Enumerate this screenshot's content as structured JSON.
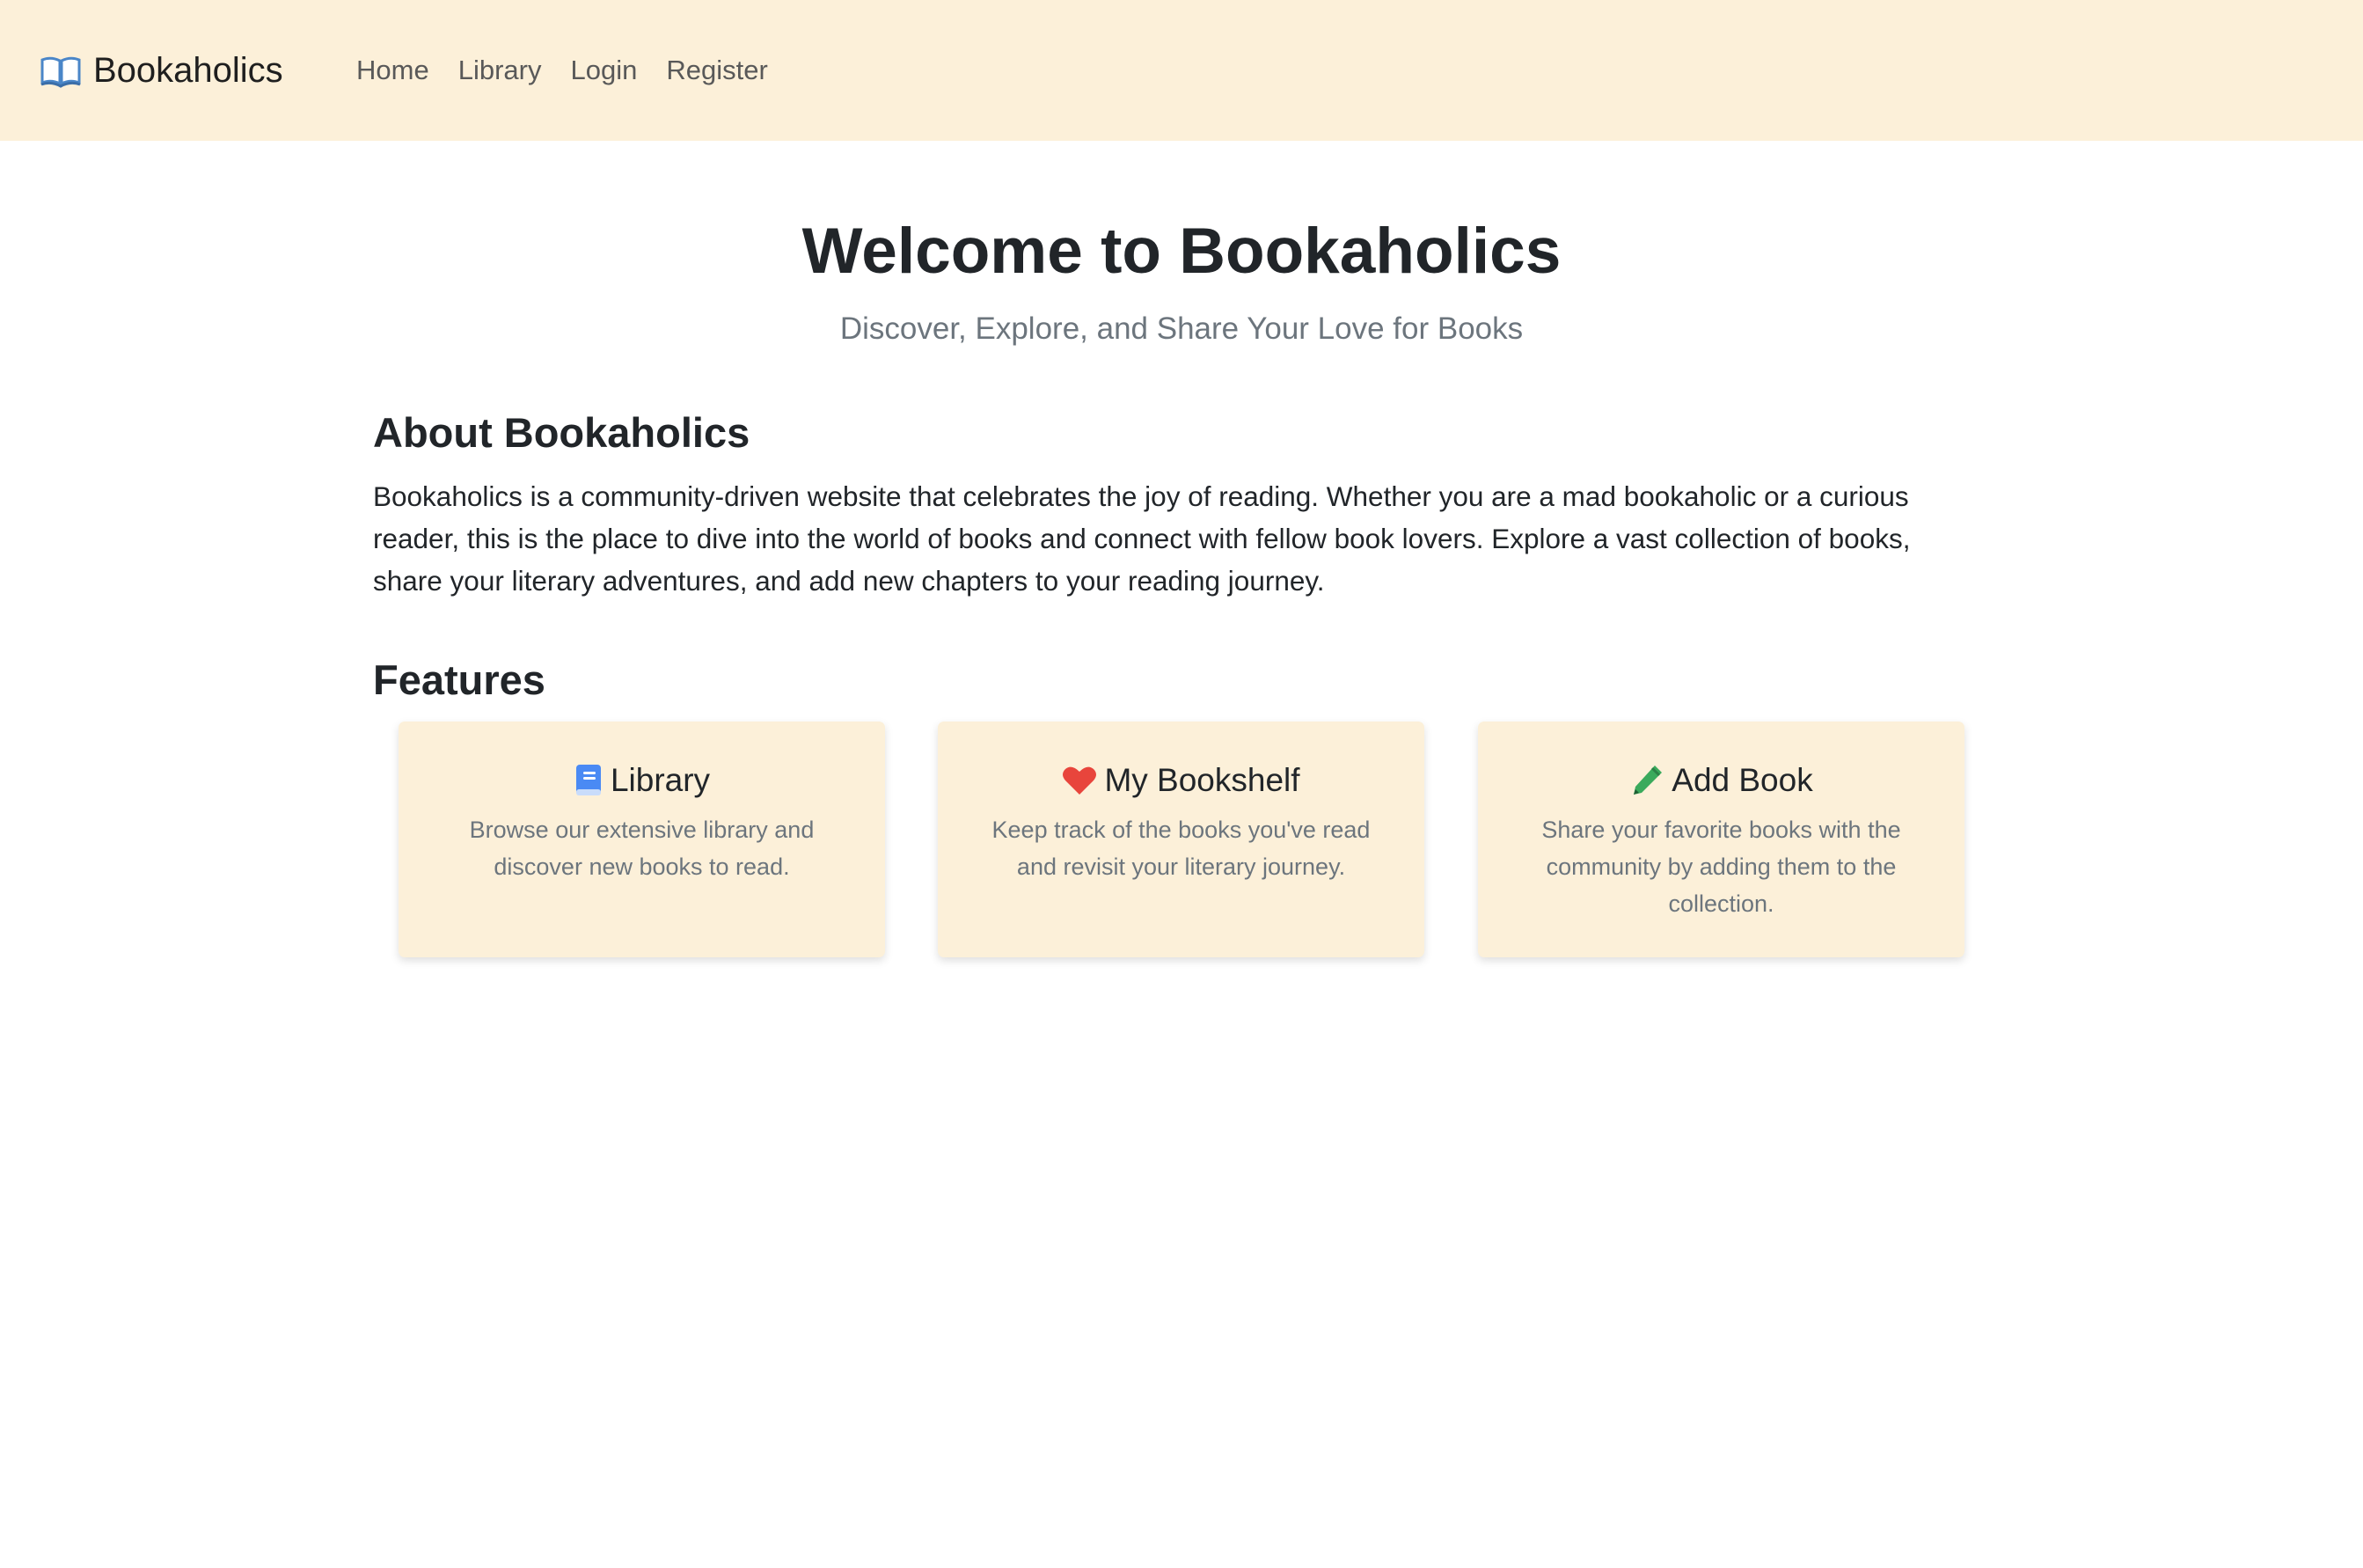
{
  "navbar": {
    "brand_icon": "open-book-icon",
    "brand": "Bookaholics",
    "links": [
      "Home",
      "Library",
      "Login",
      "Register"
    ]
  },
  "hero": {
    "title": "Welcome to Bookaholics",
    "subtitle": "Discover, Explore, and Share Your Love for Books"
  },
  "about": {
    "heading": "About Bookaholics",
    "text": "Bookaholics is a community-driven website that celebrates the joy of reading. Whether you are a mad bookaholic or a curious reader, this is the place to dive into the world of books and connect with fellow book lovers. Explore a vast collection of books, share your literary adventures, and add new chapters to your reading journey."
  },
  "features": {
    "heading": "Features",
    "cards": [
      {
        "icon": "blue-book-icon",
        "title": "Library",
        "text": "Browse our extensive library and discover new books to read."
      },
      {
        "icon": "heart-icon",
        "title": "My Bookshelf",
        "text": "Keep track of the books you've read and revisit your literary journey."
      },
      {
        "icon": "pencil-icon",
        "title": "Add Book",
        "text": "Share your favorite books with the community by adding them to the collection."
      }
    ]
  },
  "colors": {
    "navbar_bg": "#fcf0d9",
    "card_bg": "#fcf0d9",
    "heart": "#e8453c",
    "pencil": "#3aaa5c",
    "book": "#4a8af4"
  }
}
